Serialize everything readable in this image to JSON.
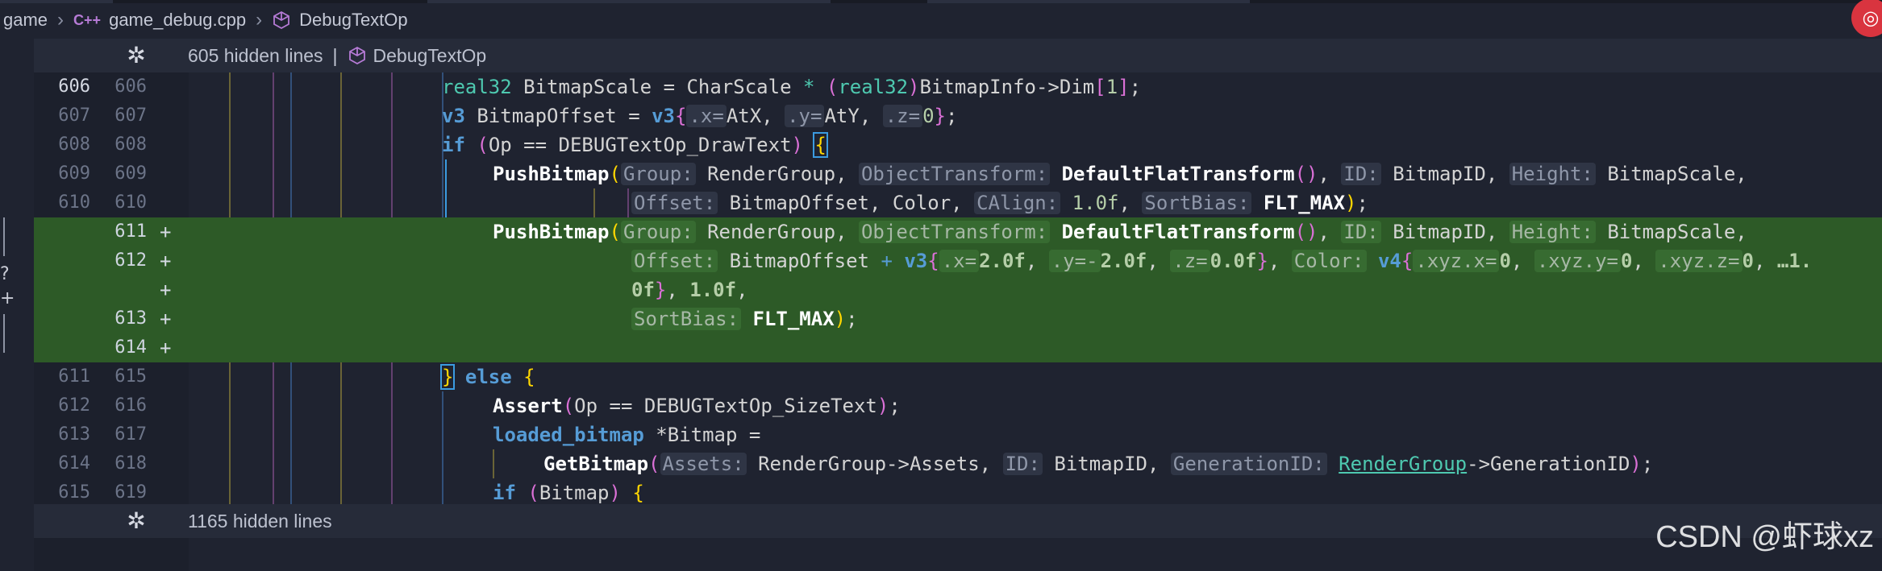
{
  "breadcrumb": {
    "items": [
      {
        "label": "game"
      },
      {
        "icon": "C++",
        "label": "game_debug.cpp"
      },
      {
        "label": "DebugTextOp"
      }
    ]
  },
  "fold_top": {
    "count_text": "605 hidden lines",
    "symbol": "DebugTextOp"
  },
  "fold_bottom": {
    "count_text": "1165 hidden lines"
  },
  "watermark": "CSDN @虾球xz",
  "lines": [
    {
      "old": "606",
      "new": "606",
      "added": false,
      "current": true
    },
    {
      "old": "607",
      "new": "607",
      "added": false
    },
    {
      "old": "608",
      "new": "608",
      "added": false
    },
    {
      "old": "609",
      "new": "609",
      "added": false
    },
    {
      "old": "610",
      "new": "610",
      "added": false
    },
    {
      "old": "",
      "new": "611",
      "added": true
    },
    {
      "old": "",
      "new": "612",
      "added": true
    },
    {
      "old": "",
      "new": "",
      "added": true
    },
    {
      "old": "",
      "new": "613",
      "added": true
    },
    {
      "old": "",
      "new": "614",
      "added": true
    },
    {
      "old": "611",
      "new": "615",
      "added": false
    },
    {
      "old": "612",
      "new": "616",
      "added": false
    },
    {
      "old": "613",
      "new": "617",
      "added": false
    },
    {
      "old": "614",
      "new": "618",
      "added": false
    },
    {
      "old": "615",
      "new": "619",
      "added": false
    }
  ],
  "tokens": {
    "real32": "real32",
    "bitmapscale": "BitmapScale",
    "eq": "=",
    "charscale": "CharScale",
    "star": "*",
    "lp": "(",
    "rp": ")",
    "bitmapinfo_dim": "BitmapInfo->Dim",
    "lb": "[",
    "rb": "]",
    "one": "1",
    "semi": ";",
    "v3": "v3",
    "bitmapoffset": "BitmapOffset",
    "lc": "{",
    "rc": "}",
    "hx": ".x=",
    "atx": "AtX",
    "comma": ",",
    "hy": ".y=",
    "aty": "AtY",
    "hz": ".z=",
    "zero": "0",
    "if": "if",
    "op": "Op",
    "eqeq": "==",
    "drawtext": "DEBUGTextOp_DrawText",
    "pushbitmap": "PushBitmap",
    "h_group": "Group:",
    "rendergroup": "RenderGroup",
    "h_objtransform": "ObjectTransform:",
    "defaultflat": "DefaultFlatTransform",
    "h_id": "ID:",
    "bitmapid": "BitmapID",
    "h_height": "Height:",
    "h_offset": "Offset:",
    "color": "Color",
    "h_calign": "CAlign:",
    "onef": "1.0f",
    "h_sortbias": "SortBias:",
    "fltmax": "FLT_MAX",
    "plus": "+",
    "twof": "2.0f",
    "h_yneg": ".y=-",
    "zerof": "0.0f",
    "h_color": "Color:",
    "v4": "v4",
    "h_xyzx": ".xyz.x=",
    "h_xyzy": ".xyz.y=",
    "h_xyzz": ".xyz.z=",
    "ellip_one": "…1.",
    "zf_tail": "0f",
    "else": "else",
    "assert": "Assert",
    "sizetext": "DEBUGTextOp_SizeText",
    "loaded_bitmap": "loaded_bitmap",
    "star_bitmap": "*Bitmap",
    "getbitmap": "GetBitmap",
    "h_assets": "Assets:",
    "rg_assets": "RenderGroup->Assets",
    "h_genid": "GenerationID:",
    "arrow_genid": "->GenerationID",
    "bitmap": "Bitmap"
  },
  "icons": {
    "unfold": "unfold-icon",
    "symbol": "cube-icon",
    "chevron": "chevron-right-icon"
  },
  "colors": {
    "added_bg": "#2d5a27",
    "editor_bg": "#1f2330",
    "keyword": "#569cd6",
    "type": "#4ec9b0"
  }
}
